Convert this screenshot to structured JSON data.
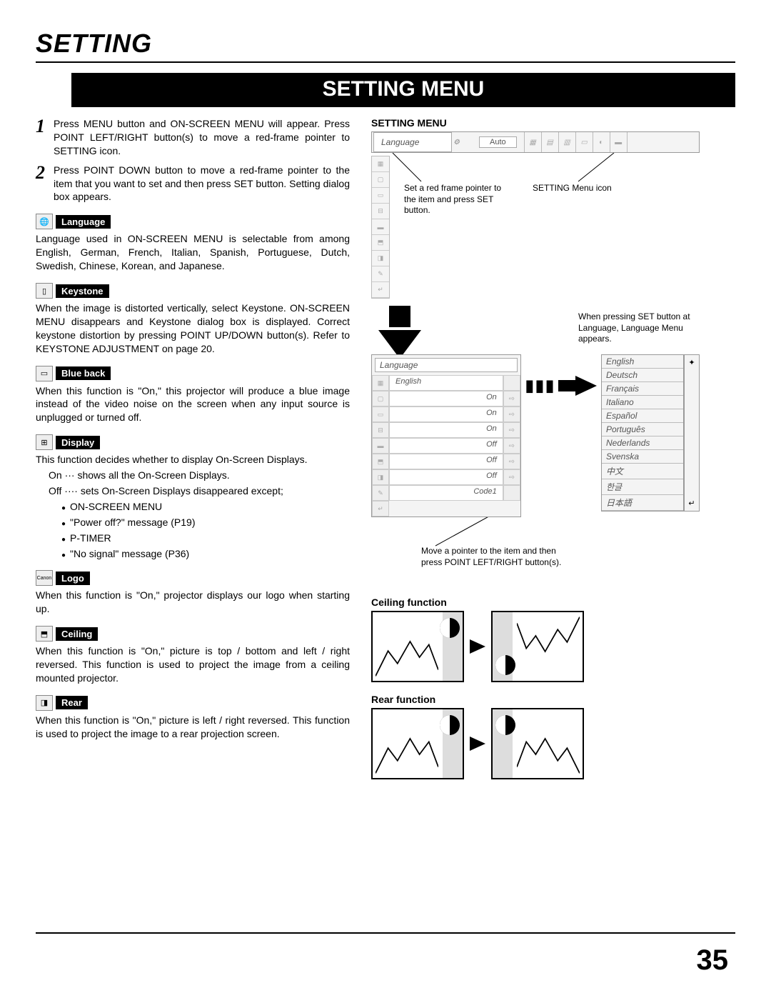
{
  "page": {
    "title": "SETTING",
    "banner": "SETTING MENU",
    "number": "35"
  },
  "steps": [
    {
      "num": "1",
      "text": "Press MENU button and ON-SCREEN MENU will appear.  Press POINT LEFT/RIGHT button(s) to move a red-frame pointer to SETTING icon."
    },
    {
      "num": "2",
      "text": "Press POINT DOWN button to move a red-frame pointer to the item that you want to set and then press SET button.  Setting dialog box appears."
    }
  ],
  "sections": {
    "language": {
      "label": "Language",
      "body": "Language used in ON-SCREEN MENU is selectable from among English, German, French, Italian, Spanish, Portuguese, Dutch, Swedish, Chinese, Korean, and Japanese."
    },
    "keystone": {
      "label": "Keystone",
      "body": "When the image is distorted vertically, select Keystone.  ON-SCREEN MENU disappears and Keystone dialog box is displayed.  Correct keystone distortion by pressing POINT UP/DOWN button(s).  Refer to KEYSTONE ADJUSTMENT on page 20."
    },
    "blueback": {
      "label": "Blue back",
      "body": "When this function is \"On,\" this projector will produce a blue image instead of the video noise on the screen when any input source is unplugged or turned off."
    },
    "display": {
      "label": "Display",
      "intro": "This function decides whether to display On-Screen Displays.",
      "on_line": "On ··· shows all the On-Screen Displays.",
      "off_line": "Off ···· sets On-Screen Displays disappeared except;",
      "bullets": [
        "ON-SCREEN MENU",
        "\"Power off?\" message (P19)",
        "P-TIMER",
        "\"No signal\" message (P36)"
      ]
    },
    "logo": {
      "label": "Logo",
      "body": "When this function is \"On,\" projector displays our logo when starting up."
    },
    "ceiling": {
      "label": "Ceiling",
      "body": "When this function is \"On,\" picture is top / bottom and left / right reversed.  This function is used to project the image from a ceiling mounted projector."
    },
    "rear": {
      "label": "Rear",
      "body": "When this function is \"On,\" picture is left / right reversed.  This function is used to project the image to a rear projection screen."
    }
  },
  "right": {
    "title": "SETTING MENU",
    "menubar_label": "Language",
    "menubar_auto": "Auto",
    "annot_pointer": "Set a red frame pointer to the item and press SET button.",
    "annot_icon": "SETTING Menu icon",
    "annot_lang": "When pressing SET button at Language, Language Menu appears.",
    "annot_move": "Move a pointer to the item and then press POINT LEFT/RIGHT button(s).",
    "dialog_hdr": "Language",
    "dialog_first": "English",
    "dialog_vals": [
      "On",
      "On",
      "On",
      "Off",
      "Off",
      "Off",
      "Code1"
    ],
    "lang_list": [
      "English",
      "Deutsch",
      "Français",
      "Italiano",
      "Español",
      "Português",
      "Nederlands",
      "Svenska",
      "中文",
      "한글",
      "日本語"
    ],
    "ceiling_title": "Ceiling function",
    "rear_title": "Rear function"
  }
}
